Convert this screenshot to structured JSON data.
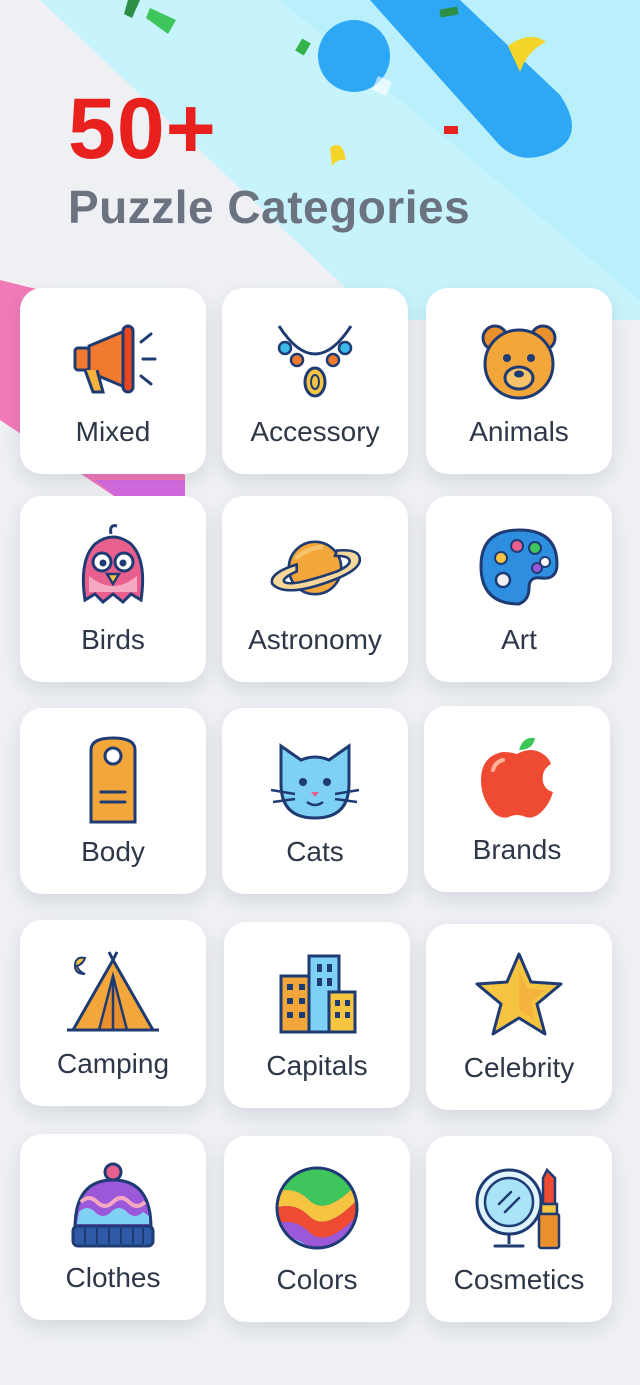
{
  "header": {
    "count": "50+",
    "subtitle": "Puzzle Categories"
  },
  "categories": [
    {
      "label": "Mixed",
      "icon": "megaphone-icon"
    },
    {
      "label": "Accessory",
      "icon": "necklace-icon"
    },
    {
      "label": "Animals",
      "icon": "bear-icon"
    },
    {
      "label": "Birds",
      "icon": "bird-icon"
    },
    {
      "label": "Astronomy",
      "icon": "planet-icon"
    },
    {
      "label": "Art",
      "icon": "palette-icon"
    },
    {
      "label": "Body",
      "icon": "door-hanger-icon"
    },
    {
      "label": "Cats",
      "icon": "cat-icon"
    },
    {
      "label": "Brands",
      "icon": "apple-icon"
    },
    {
      "label": "Camping",
      "icon": "tent-icon"
    },
    {
      "label": "Capitals",
      "icon": "buildings-icon"
    },
    {
      "label": "Celebrity",
      "icon": "star-icon"
    },
    {
      "label": "Clothes",
      "icon": "beanie-icon"
    },
    {
      "label": "Colors",
      "icon": "color-ball-icon"
    },
    {
      "label": "Cosmetics",
      "icon": "mirror-lipstick-icon"
    }
  ],
  "colors": {
    "accent_red": "#e8201e",
    "subtitle_gray": "#6b7280",
    "card_bg": "#ffffff",
    "page_bg": "#eef0f4",
    "stripe_cyan": "#b9f0fb",
    "stripe_blue": "#2ea7f5"
  }
}
